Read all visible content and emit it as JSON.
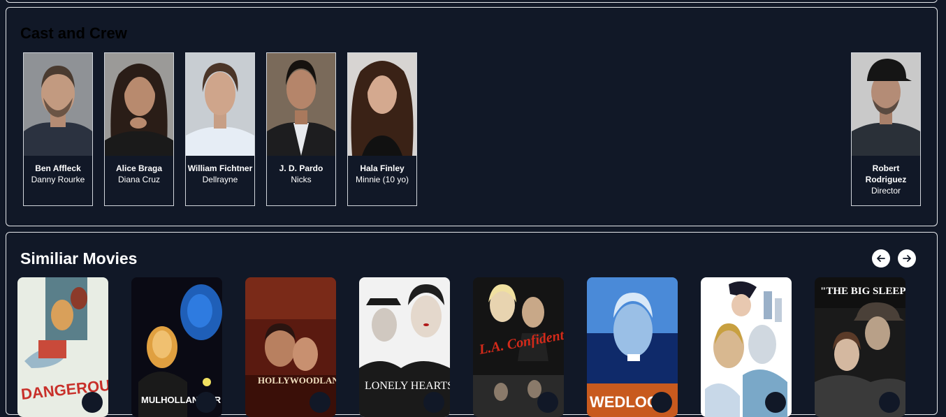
{
  "cast_section": {
    "title": "Cast and Crew",
    "members": [
      {
        "name": "Ben Affleck",
        "role": "Danny Rourke"
      },
      {
        "name": "Alice Braga",
        "role": "Diana Cruz"
      },
      {
        "name": "William Fichtner",
        "role": "Dellrayne"
      },
      {
        "name": "J. D. Pardo",
        "role": "Nicks"
      },
      {
        "name": "Hala Finley",
        "role": "Minnie (10 yo)"
      },
      {
        "name": "Robert Rodriguez",
        "role": "Director"
      }
    ]
  },
  "similar_section": {
    "title": "Similiar Movies",
    "prev_icon": "arrow-left-icon",
    "next_icon": "arrow-right-icon",
    "movies": [
      {
        "poster_text": "DANGEROUS CARGO"
      },
      {
        "poster_text": "MULHOLLAND DR"
      },
      {
        "poster_text": "HOLLYWOODLAND"
      },
      {
        "poster_text": "LONELY HEARTS"
      },
      {
        "poster_text": "L.A. Confidential"
      },
      {
        "poster_text": "WEDLOCK"
      },
      {
        "poster_text": ""
      },
      {
        "poster_text": "\"THE BIG SLEEP\""
      }
    ]
  }
}
